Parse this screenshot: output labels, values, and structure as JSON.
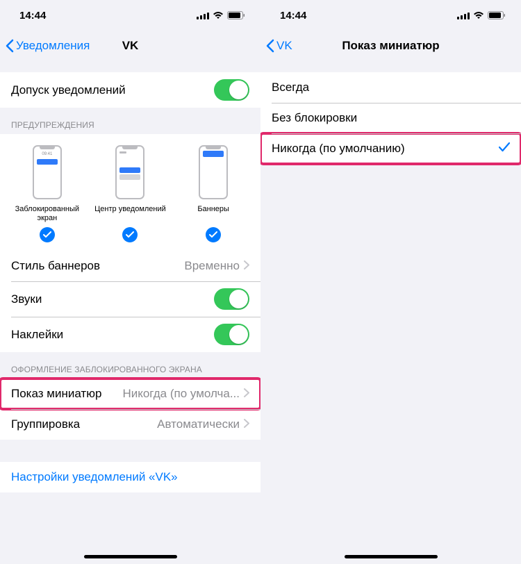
{
  "status": {
    "time": "14:44"
  },
  "left": {
    "back": "Уведомления",
    "title": "VK",
    "allow_label": "Допуск уведомлений",
    "alerts_header": "ПРЕДУПРЕЖДЕНИЯ",
    "alerts": {
      "lock": "Заблокированный экран",
      "center": "Центр уведомлений",
      "banner": "Баннеры",
      "lock_time": "09:41"
    },
    "banner_style_label": "Стиль баннеров",
    "banner_style_value": "Временно",
    "sounds_label": "Звуки",
    "stickers_label": "Наклейки",
    "lockscreen_header": "ОФОРМЛЕНИЕ ЗАБЛОКИРОВАННОГО ЭКРАНА",
    "previews_label": "Показ миниатюр",
    "previews_value": "Никогда (по умолча...",
    "grouping_label": "Группировка",
    "grouping_value": "Автоматически",
    "app_settings": "Настройки уведомлений «VK»"
  },
  "right": {
    "back": "VK",
    "title": "Показ миниатюр",
    "options": {
      "always": "Всегда",
      "unlocked": "Без блокировки",
      "never": "Никогда (по умолчанию)"
    }
  }
}
